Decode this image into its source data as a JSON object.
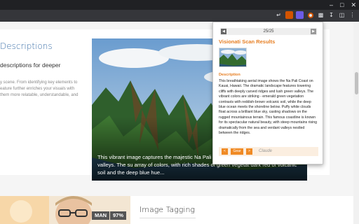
{
  "browser": {
    "window_controls": [
      "–",
      "□",
      "✕"
    ],
    "toolbar_icons": [
      "share-icon",
      "extension-icon",
      "visionati-extension-icon",
      "record-icon",
      "puzzle-icon",
      "download-icon",
      "sidebar-icon",
      "menu-icon"
    ]
  },
  "page": {
    "section_title": "Descriptions",
    "section_subtitle": "descriptions for deeper",
    "section_body": "y scene. From identifying key elements to eature further enriches your visuals with them more relatable, understandable, and",
    "hero_caption": "This vibrant image captures the majestic Na Pali its dramatic cliffs and deep green valleys. The su array of colors, with rich shades of green vegetat dark red of volcanic soil and the deep blue hue...",
    "image_tagging_title": "Image Tagging",
    "tags": [
      "MAN",
      "97%"
    ]
  },
  "popup": {
    "counter": "25/25",
    "prev": "◀",
    "next": "▶",
    "title": "Visionati Scan Results",
    "description_label": "Description",
    "description": "This breathtaking aerial image shows the Na Pali Coast on Kauai, Hawaii. The dramatic landscape features towering cliffs with deeply carved ridges and lush green valleys. The vibrant colors are striking - emerald green vegetation contrasts with reddish-brown volcanic soil, while the deep blue ocean meets the shoreline below. Puffy white clouds float across a brilliant blue sky, casting shadows on the rugged mountainous terrain. This famous coastline is known for its spectacular natural beauty, with steep mountains rising dramatically from the sea and verdant valleys nestled between the ridges.",
    "footer": {
      "prev": "<",
      "option": "Gear",
      "next": ">",
      "model": "Claude"
    }
  },
  "colors": {
    "accent": "#e67e22",
    "link_title": "#3a6fa8"
  }
}
